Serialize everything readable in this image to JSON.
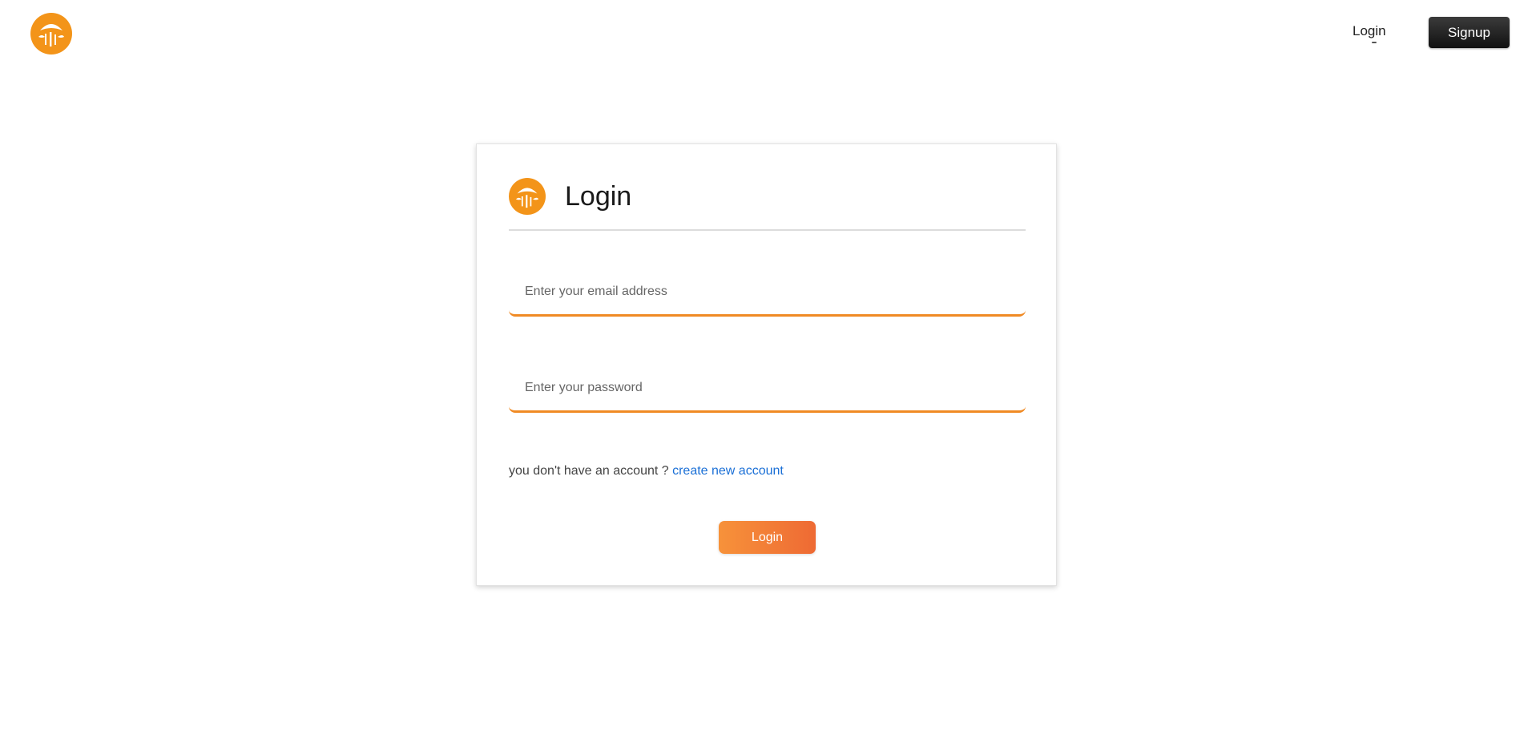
{
  "nav": {
    "logo_icon": "restaurant-logo-icon",
    "login_label": "Login",
    "signup_label": "Signup"
  },
  "card": {
    "logo_icon": "restaurant-logo-icon",
    "title": "Login",
    "email_placeholder": "Enter your email address",
    "email_value": "",
    "password_placeholder": "Enter your password",
    "password_value": "",
    "no_account_text": "you don't have an account ? ",
    "create_account_link": "create new account",
    "login_button": "Login"
  },
  "colors": {
    "brand_orange": "#f08a24",
    "button_gradient_start": "#f7923a",
    "button_gradient_end": "#ee6a34",
    "link_blue": "#1a6fd6",
    "signup_button_bg": "#1f1f1f"
  }
}
